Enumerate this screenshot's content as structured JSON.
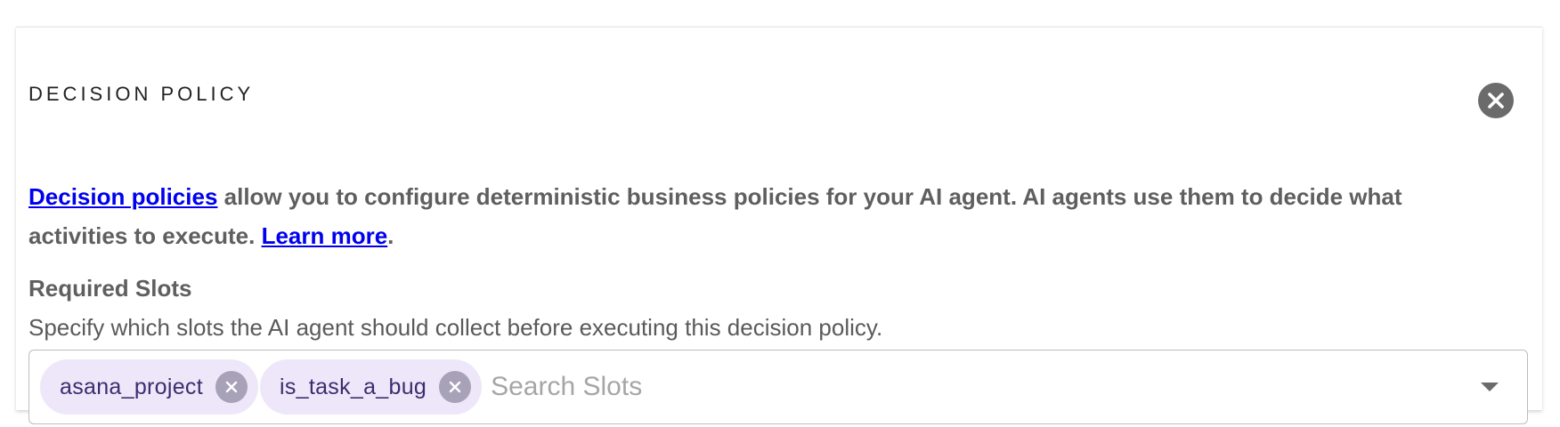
{
  "panel": {
    "title": "DECISION POLICY",
    "close_icon": "close-circle-icon"
  },
  "description": {
    "link_text": "Decision policies",
    "body": " allow you to configure deterministic business policies for your AI agent. AI agents use them to decide what activities to execute. ",
    "learn_more_text": "Learn more",
    "trailing": "."
  },
  "required_slots": {
    "label": "Required Slots",
    "help_text": "Specify which slots the AI agent should collect before executing this decision policy.",
    "selected": [
      {
        "label": "asana_project"
      },
      {
        "label": "is_task_a_bug"
      }
    ],
    "search_placeholder": "Search Slots",
    "search_value": "",
    "dropdown_icon": "caret-down-icon"
  },
  "colors": {
    "link": "#0000ee",
    "chip_background": "#ede7f9",
    "chip_text": "#3d2c6e",
    "close_button": "#6b6b6b"
  }
}
